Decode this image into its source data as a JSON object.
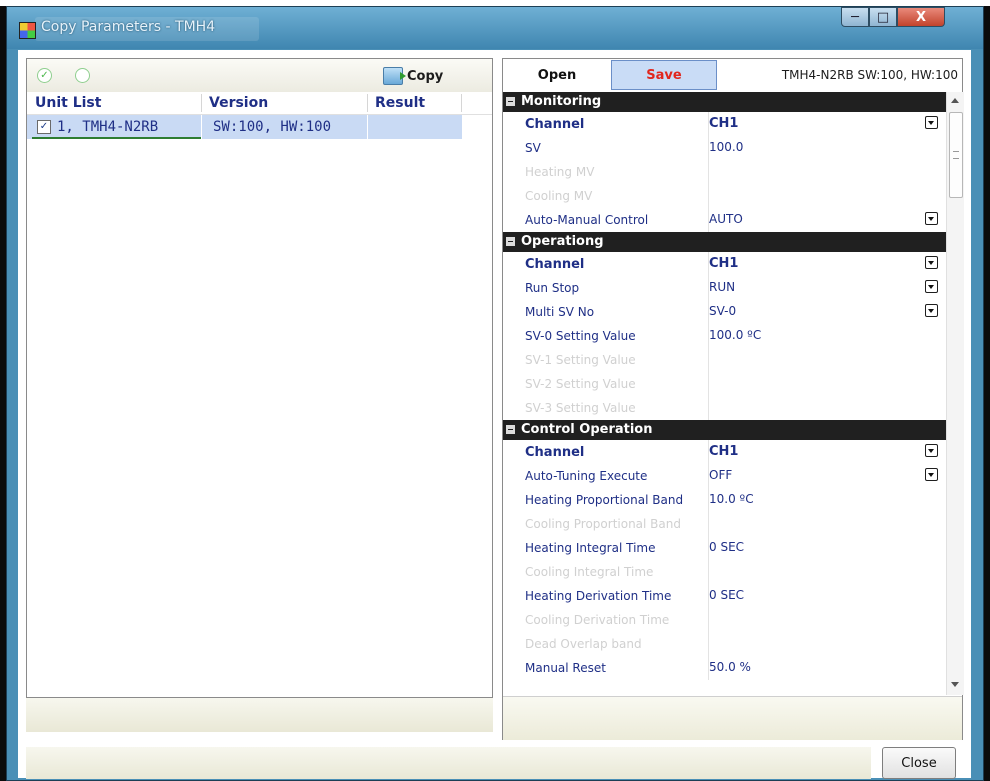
{
  "window": {
    "title": "Copy Parameters - TMH4",
    "controls": {
      "minimize": "─",
      "maximize": "□",
      "close": "X"
    }
  },
  "left": {
    "toolbar": {
      "copy_label": "Copy"
    },
    "columns": [
      "Unit List",
      "Version",
      "Result"
    ],
    "units": [
      {
        "checked": true,
        "unit": "1, TMH4-N2RB",
        "version": "SW:100, HW:100",
        "result": ""
      }
    ]
  },
  "right": {
    "toolbar": {
      "open_label": "Open",
      "save_label": "Save",
      "device_info": "TMH4-N2RB  SW:100, HW:100"
    },
    "sections": [
      {
        "title": "Monitoring",
        "rows": [
          {
            "name": "Channel",
            "value": "CH1",
            "bold": true,
            "disabled": false,
            "dropdown": true
          },
          {
            "name": "SV",
            "value": "100.0",
            "bold": false,
            "disabled": false,
            "dropdown": false
          },
          {
            "name": "Heating MV",
            "value": "",
            "bold": false,
            "disabled": true,
            "dropdown": false
          },
          {
            "name": "Cooling MV",
            "value": "",
            "bold": false,
            "disabled": true,
            "dropdown": false
          },
          {
            "name": "Auto-Manual Control",
            "value": "AUTO",
            "bold": false,
            "disabled": false,
            "dropdown": true
          }
        ]
      },
      {
        "title": "Operationg",
        "rows": [
          {
            "name": "Channel",
            "value": "CH1",
            "bold": true,
            "disabled": false,
            "dropdown": true
          },
          {
            "name": "Run Stop",
            "value": "RUN",
            "bold": false,
            "disabled": false,
            "dropdown": true
          },
          {
            "name": "Multi SV No",
            "value": "SV-0",
            "bold": false,
            "disabled": false,
            "dropdown": true
          },
          {
            "name": "SV-0 Setting Value",
            "value": "100.0 ºC",
            "bold": false,
            "disabled": false,
            "dropdown": false
          },
          {
            "name": "SV-1 Setting Value",
            "value": "",
            "bold": false,
            "disabled": true,
            "dropdown": false
          },
          {
            "name": "SV-2 Setting Value",
            "value": "",
            "bold": false,
            "disabled": true,
            "dropdown": false
          },
          {
            "name": "SV-3 Setting Value",
            "value": "",
            "bold": false,
            "disabled": true,
            "dropdown": false
          }
        ]
      },
      {
        "title": "Control Operation",
        "rows": [
          {
            "name": "Channel",
            "value": "CH1",
            "bold": true,
            "disabled": false,
            "dropdown": true
          },
          {
            "name": "Auto-Tuning Execute",
            "value": "OFF",
            "bold": false,
            "disabled": false,
            "dropdown": true
          },
          {
            "name": "Heating Proportional Band",
            "value": "10.0 ºC",
            "bold": false,
            "disabled": false,
            "dropdown": false
          },
          {
            "name": "Cooling Proportional Band",
            "value": "",
            "bold": false,
            "disabled": true,
            "dropdown": false
          },
          {
            "name": "Heating Integral Time",
            "value": "0 SEC",
            "bold": false,
            "disabled": false,
            "dropdown": false
          },
          {
            "name": "Cooling Integral Time",
            "value": "",
            "bold": false,
            "disabled": true,
            "dropdown": false
          },
          {
            "name": "Heating Derivation Time",
            "value": "0 SEC",
            "bold": false,
            "disabled": false,
            "dropdown": false
          },
          {
            "name": "Cooling Derivation Time",
            "value": "",
            "bold": false,
            "disabled": true,
            "dropdown": false
          },
          {
            "name": "Dead Overlap band",
            "value": "",
            "bold": false,
            "disabled": true,
            "dropdown": false
          },
          {
            "name": "Manual Reset",
            "value": "50.0 %",
            "bold": false,
            "disabled": false,
            "dropdown": false
          }
        ]
      }
    ]
  },
  "footer": {
    "close_label": "Close"
  },
  "colors": {
    "title_bar": "#4a8fb6",
    "section_bg": "#202020",
    "param_text": "#1f2f86",
    "save_text": "#e1261d",
    "selected_row": "#c9daf4"
  }
}
